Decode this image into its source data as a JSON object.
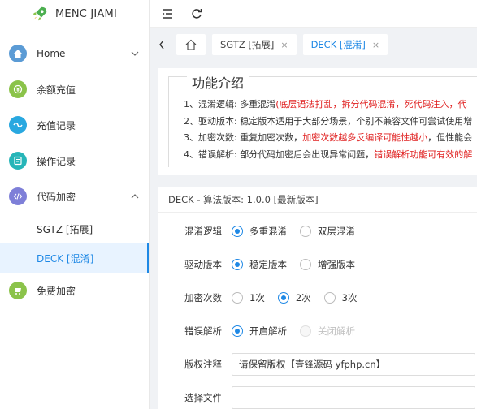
{
  "app": {
    "title": "MENC JIAMI"
  },
  "sidebar": {
    "items": [
      {
        "label": "Home",
        "icon": "home-icon",
        "color": "#5b9bd5",
        "has_arrow": true
      },
      {
        "label": "余额充值",
        "icon": "recharge-icon",
        "color": "#8bc34a"
      },
      {
        "label": "充值记录",
        "icon": "record-icon",
        "color": "#29a8e0"
      },
      {
        "label": "操作记录",
        "icon": "operation-icon",
        "color": "#26b5b8"
      },
      {
        "label": "代码加密",
        "icon": "code-icon",
        "color": "#7e7fd8",
        "expanded": true,
        "children": [
          {
            "label": "SGTZ [拓展]"
          },
          {
            "label": "DECK [混淆]",
            "active": true
          }
        ]
      },
      {
        "label": "免费加密",
        "icon": "free-icon",
        "color": "#8bc34a"
      }
    ]
  },
  "topbar": {
    "menu_toggle_icon": "menu-fold-icon",
    "refresh_icon": "refresh-icon"
  },
  "tabs": [
    {
      "label": "SGTZ [拓展]",
      "close": "×"
    },
    {
      "label": "DECK [混淆]",
      "close": "×",
      "active": true
    }
  ],
  "intro": {
    "title": "功能介绍",
    "lines": [
      {
        "normal": "1、混淆逻辑: 多重混淆",
        "red": "(底层语法打乱，拆分代码混淆，死代码注入，代"
      },
      {
        "normal": "2、驱动版本: 稳定版本适用于大部分场景，个别不兼容文件可尝试使用增",
        "red": ""
      },
      {
        "normal": "3、加密次数: 重复加密次数，",
        "red": "加密次数越多反编译可能性越小",
        "tail": "，但性能会"
      },
      {
        "normal": "4、错误解析: 部分代码加密后会出现异常问题，",
        "red": "错误解析功能可有效的解"
      }
    ]
  },
  "form": {
    "header": "DECK - 算法版本: 1.0.0 [最新版本]",
    "fields": [
      {
        "label": "混淆逻辑",
        "options": [
          {
            "label": "多重混淆",
            "checked": true
          },
          {
            "label": "双层混淆"
          }
        ]
      },
      {
        "label": "驱动版本",
        "options": [
          {
            "label": "稳定版本",
            "checked": true
          },
          {
            "label": "增强版本"
          }
        ]
      },
      {
        "label": "加密次数",
        "options": [
          {
            "label": "1次"
          },
          {
            "label": "2次",
            "checked": true
          },
          {
            "label": "3次"
          }
        ]
      },
      {
        "label": "错误解析",
        "options": [
          {
            "label": "开启解析",
            "checked": true
          },
          {
            "label": "关闭解析",
            "disabled": true
          }
        ]
      }
    ],
    "copyright": {
      "label": "版权注释",
      "value": "请保留版权【壹锋源码 yfphp.cn】"
    },
    "file": {
      "label": "选择文件"
    }
  },
  "colors": {
    "accent": "#1e88e5",
    "warn": "#e02020"
  }
}
